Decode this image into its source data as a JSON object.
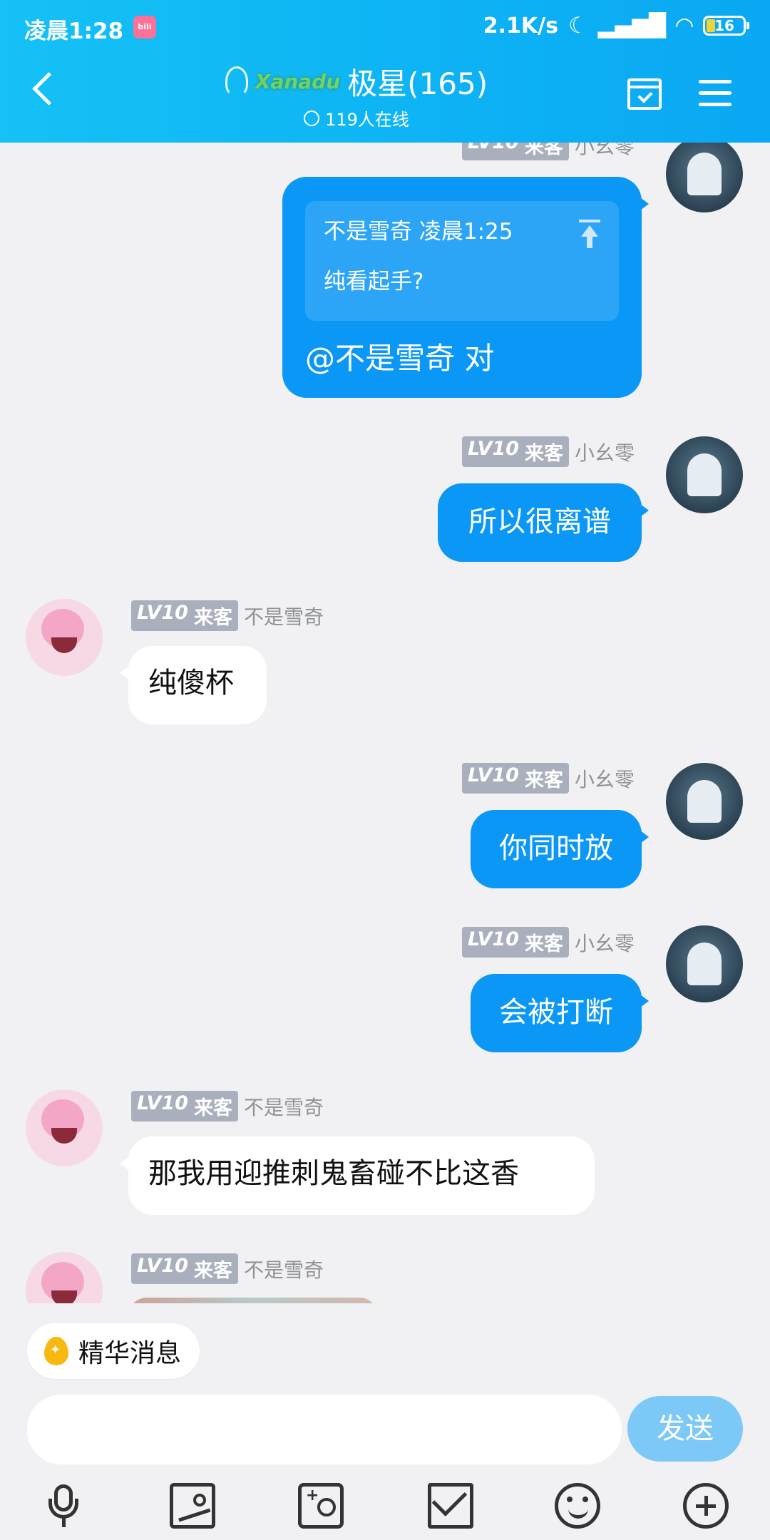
{
  "status_bar": {
    "time": "凌晨1:28",
    "net_speed": "2.1K/s",
    "battery": "16"
  },
  "header": {
    "brand_logo": "Xanadu",
    "title": "极星(165)",
    "online": "119人在线"
  },
  "messages": [
    {
      "sender": "小幺零",
      "level": "LV10",
      "role": "来客",
      "quote_author_time": "不是雪奇 凌晨1:25",
      "quote_text": "纯看起手?",
      "text": "@不是雪奇 对"
    },
    {
      "sender": "小幺零",
      "level": "LV10",
      "role": "来客",
      "text": "所以很离谱"
    },
    {
      "sender": "不是雪奇",
      "level": "LV10",
      "role": "来客",
      "text": "纯傻杯"
    },
    {
      "sender": "小幺零",
      "level": "LV10",
      "role": "来客",
      "text": "你同时放"
    },
    {
      "sender": "小幺零",
      "level": "LV10",
      "role": "来客",
      "text": "会被打断"
    },
    {
      "sender": "不是雪奇",
      "level": "LV10",
      "role": "来客",
      "text": "那我用迎推刺鬼畜碰不比这香"
    },
    {
      "sender": "不是雪奇",
      "level": "LV10",
      "role": "来客",
      "text": ""
    }
  ],
  "composer": {
    "essence_label": "精华消息",
    "input_value": "",
    "send_label": "发送"
  }
}
